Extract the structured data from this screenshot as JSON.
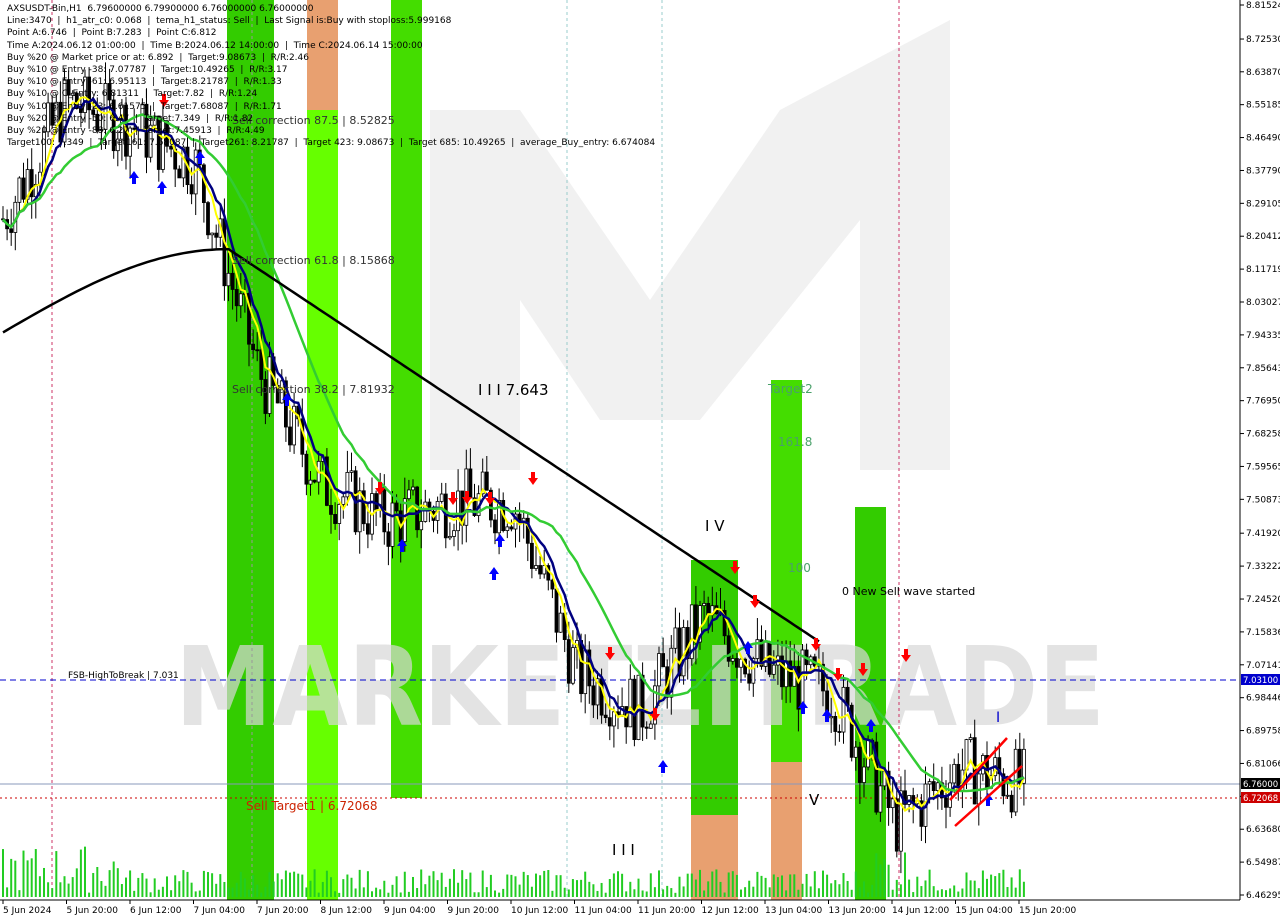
{
  "header": {
    "lines": [
      "AXSUSDT-Bin,H1  6.79600000 6.79900000 6.76000000 6.76000000",
      "Line:3470  |  h1_atr_c0: 0.068  |  tema_h1_status: Sell  |  Last Signal is:Buy with stoploss:5.999168",
      "Point A:6.746  |  Point B:7.283  |  Point C:6.812",
      "Time A:2024.06.12 01:00:00  |  Time B:2024.06.12 14:00:00  |  Time C:2024.06.14 15:00:00",
      "Buy %20 @ Market price or at: 6.892  |  Target:9.08673  |  R/R:2.46",
      "Buy %10 @ Entry -38: 7.07787  |  Target:10.49265  |  R/R:3.17",
      "Buy %10 @ Entry -61: 6.95113  |  Target:8.21787  |  R/R:1.33",
      "Buy %10 @ C_Entry: 6.81311  |  Target:7.82  |  R/R:1.24",
      "Buy %10 @ Entry -23: 6.61575  |  Target:7.68087  |  R/R:1.71",
      "Buy %20 @ Entry -50: 6.47  |  Target:7.349  |  R/R:1.82",
      "Buy %20 @ Entry -88: 6.27  |  Target:7.45913  |  R/R:4.49",
      "Target100: 7.349  |  Target161: 7.68087  |  Target261: 8.21787  |  Target 423: 9.08673  |  Target 685: 10.49265  |  average_Buy_entry: 6.674084"
    ]
  },
  "annotations": {
    "sell_corr_875": "Sell correction 87.5 | 8.52825",
    "sell_corr_618": "Sell correction 61.8 | 8.15868",
    "sell_corr_382": "Sell correction 38.2 | 7.81932",
    "wave_III_top": "I I I 7.643",
    "wave_IV": "I V",
    "wave_III_low": "I I I",
    "wave_V": "V",
    "target2": "Target2",
    "fib_1618": "161.8",
    "fib_100": "100",
    "new_sell": "0 New Sell wave started",
    "fsb_label": "FSB-HighToBreak | 7.031",
    "sell_target1": "Sell Target1 | 6.72068",
    "wave_I": "I",
    "watermark": "MARKETZITRADE"
  },
  "price_axis": {
    "ticks": [
      "8.81524",
      "8.72530",
      "8.63870",
      "8.55185",
      "8.46490",
      "8.37790",
      "8.29105",
      "8.20412",
      "8.11719",
      "8.03027",
      "7.94335",
      "7.85643",
      "7.76950",
      "7.68258",
      "7.59565",
      "7.50873",
      "7.41920",
      "7.33222",
      "7.24520",
      "7.15836",
      "7.07141",
      "6.98446",
      "6.89758",
      "6.81066",
      "6.72373",
      "6.63680",
      "6.54987",
      "6.46295"
    ],
    "badge_fsb": "7.03100",
    "badge_price": "6.76000",
    "badge_target": "6.72068"
  },
  "time_axis": {
    "ticks": [
      "5 Jun 2024",
      "5 Jun 20:00",
      "6 Jun 12:00",
      "7 Jun 04:00",
      "7 Jun 20:00",
      "8 Jun 12:00",
      "9 Jun 04:00",
      "9 Jun 20:00",
      "10 Jun 12:00",
      "11 Jun 04:00",
      "11 Jun 20:00",
      "12 Jun 12:00",
      "13 Jun 04:00",
      "13 Jun 20:00",
      "14 Jun 12:00",
      "15 Jun 04:00",
      "15 Jun 20:00"
    ]
  },
  "colors": {
    "up_candle": "#000000",
    "green_bar": "#33cc00",
    "bright_green_bar": "#66ff00",
    "orange_bar": "#e8a070",
    "ma_green": "#33cc33",
    "ma_navy": "#000080",
    "ma_yellow": "#ffff00",
    "ma_black": "#000000",
    "fsb_line": "#0000cc",
    "target_line": "#cc0000",
    "watermark": "#d8d8d8"
  },
  "chart_data": {
    "type": "candlestick",
    "symbol": "AXSUSDT-Bin",
    "timeframe": "H1",
    "ylim": [
      6.46295,
      8.81524
    ],
    "last_ohlc": {
      "open": 6.796,
      "high": 6.799,
      "low": 6.76,
      "close": 6.76
    },
    "levels": {
      "fsb_high_to_break": 7.031,
      "sell_target1": 6.72068,
      "current_price": 6.76
    },
    "close_path": [
      {
        "x": "5 Jun 2024",
        "y": 8.25
      },
      {
        "x": "5 Jun 20:00",
        "y": 8.56
      },
      {
        "x": "6 Jun 12:00",
        "y": 8.5
      },
      {
        "x": "7 Jun 04:00",
        "y": 8.4
      },
      {
        "x": "7 Jun 20:00",
        "y": 7.85
      },
      {
        "x": "8 Jun 12:00",
        "y": 7.55
      },
      {
        "x": "9 Jun 04:00",
        "y": 7.45
      },
      {
        "x": "9 Jun 20:00",
        "y": 7.5
      },
      {
        "x": "10 Jun 12:00",
        "y": 7.5
      },
      {
        "x": "11 Jun 04:00",
        "y": 7.05
      },
      {
        "x": "11 Jun 20:00",
        "y": 6.95
      },
      {
        "x": "12 Jun 12:00",
        "y": 7.2
      },
      {
        "x": "13 Jun 04:00",
        "y": 7.05
      },
      {
        "x": "13 Jun 20:00",
        "y": 7.0
      },
      {
        "x": "14 Jun 12:00",
        "y": 6.65
      },
      {
        "x": "15 Jun 04:00",
        "y": 6.8
      },
      {
        "x": "15 Jun 20:00",
        "y": 6.76
      }
    ]
  }
}
